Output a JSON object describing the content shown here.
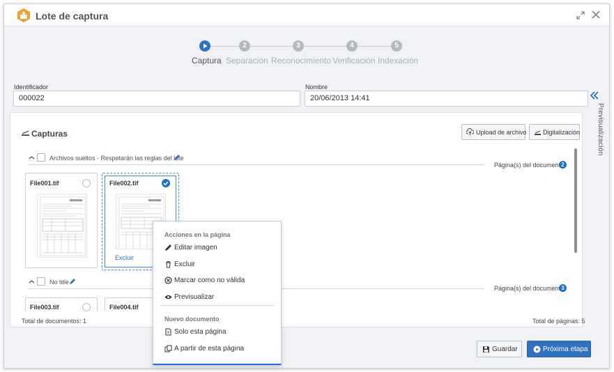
{
  "window": {
    "title": "Lote de captura"
  },
  "stepper": {
    "steps": [
      {
        "number": "",
        "label": "Captura",
        "state": "active"
      },
      {
        "number": "2",
        "label": "Separación",
        "state": "pending"
      },
      {
        "number": "3",
        "label": "Reconocimiento",
        "state": "pending"
      },
      {
        "number": "4",
        "label": "Verificación",
        "state": "pending"
      },
      {
        "number": "5",
        "label": "Indexación",
        "state": "pending"
      }
    ]
  },
  "form": {
    "identifier_label": "Identificador",
    "identifier_value": "000022",
    "name_label": "Nombre",
    "name_value": "20/06/2013 14:41"
  },
  "side_panel": {
    "label": "Previsualización"
  },
  "captures": {
    "title": "Capturas",
    "upload_label": "Upload de archivo",
    "scan_label": "Digitalización",
    "groups": [
      {
        "name": "Archivos sueltos - Respetarán las reglas del lote",
        "pages_label": "Página(s) del documento",
        "pages_count": "2",
        "files": [
          {
            "name": "File001.tif",
            "selected": false
          },
          {
            "name": "File002.tif",
            "selected": true,
            "action": "Excluir"
          }
        ]
      },
      {
        "name": "No title",
        "pages_label": "Página(s) del documento",
        "pages_count": "3",
        "files": [
          {
            "name": "File003.tif",
            "selected": false
          },
          {
            "name": "File004.tif",
            "selected": false
          }
        ]
      }
    ],
    "total_documents": "Total de documentos: 1",
    "total_pages": "Total de páginas: 5"
  },
  "context_menu": {
    "page_actions_header": "Acciones en la página",
    "edit_image": "Editar imagen",
    "exclude": "Excluir",
    "mark_invalid": "Marcar como no válida",
    "preview": "Previsualizar",
    "new_document_header": "Nuevo documento",
    "only_this_page": "Solo esta página",
    "from_this_page": "A partir de esta página"
  },
  "footer": {
    "save_label": "Guardar",
    "next_label": "Próxima etapa"
  },
  "colors": {
    "accent": "#2f73c0",
    "badge": "#1e6fc7",
    "title_icon": "#f0a12b"
  }
}
